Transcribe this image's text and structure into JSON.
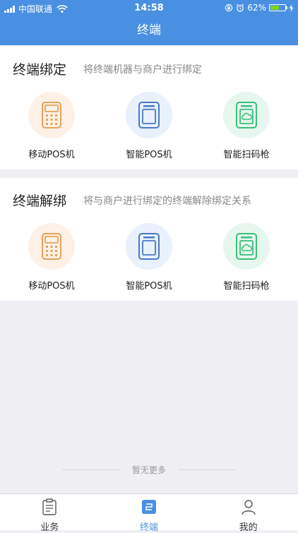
{
  "status_bar": {
    "carrier": "中国联通",
    "time": "14:58",
    "battery": "62%"
  },
  "nav": {
    "title": "终端"
  },
  "bind_section": {
    "title": "终端绑定",
    "description": "将终端机器与商户进行绑定",
    "items": [
      {
        "label": "移动POS机",
        "icon": "mobile-pos-icon",
        "color": "#e8a25a"
      },
      {
        "label": "智能POS机",
        "icon": "smart-pos-icon",
        "color": "#4a78c8"
      },
      {
        "label": "智能扫码枪",
        "icon": "scanner-icon",
        "color": "#3bbf7a"
      }
    ]
  },
  "unbind_section": {
    "title": "终端解绑",
    "description": "将与商户进行绑定的终端解除绑定关系",
    "items": [
      {
        "label": "移动POS机",
        "icon": "mobile-pos-icon",
        "color": "#e8a25a"
      },
      {
        "label": "智能POS机",
        "icon": "smart-pos-icon",
        "color": "#4a78c8"
      },
      {
        "label": "智能扫码枪",
        "icon": "scanner-icon",
        "color": "#3bbf7a"
      }
    ]
  },
  "footer_note": "暂无更多",
  "tabbar": {
    "items": [
      {
        "label": "业务",
        "icon": "clipboard-icon",
        "active": false
      },
      {
        "label": "终端",
        "icon": "terminal-icon",
        "active": true
      },
      {
        "label": "我的",
        "icon": "user-icon",
        "active": false
      }
    ],
    "active_color": "#4a90e2"
  }
}
